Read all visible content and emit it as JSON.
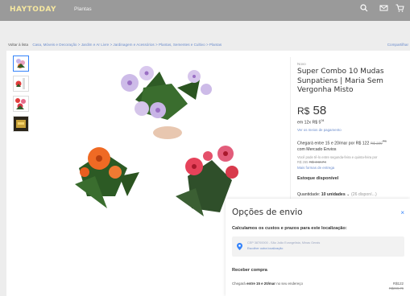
{
  "header": {
    "logo": "HAYTODAY",
    "nav_link": "Plantas",
    "icons": [
      "search-icon",
      "mail-icon",
      "cart-icon"
    ],
    "bg_color": "#9a9a9a"
  },
  "breadcrumb": {
    "back": "Voltar à lista",
    "path": "Casa, Móveis e Decoração > Jardim e Ar Livre > Jardinagem e Acessórios > Plantas, Sementes e Cultivo > Plantas",
    "share": "Compartilhar"
  },
  "product": {
    "condition": "Novo",
    "title": "Super Combo 10 Mudas Sunpatiens | Maria Sem Vergonha Misto",
    "price_currency": "R$",
    "price_value": "58",
    "installments_prefix": "em 12x R$",
    "installments_value": "5",
    "installments_cents": "04",
    "payment_link": "Ver os meios de pagamento",
    "delivery_prefix": "Chegará entre 15 e 20/mar por R$",
    "delivery_price": "122",
    "delivery_old": "R$ 299",
    "delivery_old_cents": "76",
    "delivery_suffix": "com Mercado Envios",
    "alt_delivery": "Você pode tê-lo entre segunda-feira e quinta-feira por",
    "alt_price": "R$ 265",
    "alt_old": "R$ 442,74",
    "more_delivery": "Mais formas de entrega",
    "stock": "Estoque disponível",
    "qty_label": "Quantidade:",
    "qty_value": "10 unidades",
    "qty_avail": "(26 disponí...)"
  },
  "modal": {
    "title": "Opções de envio",
    "close": "×",
    "subtitle": "Calculamos os custos e prazos para este localização:",
    "address": "CEP 38700000 - São João Evangelista, Minas Gerais",
    "change_location": "Escolher outra localização",
    "receive": "Receber compra",
    "line_prefix": "Chegará",
    "line_bold": "entre 15 e 20/mar",
    "line_suffix": "no seu endereço",
    "price": "R$122",
    "price_old": "R$299,76"
  },
  "colors": {
    "accent": "#3483fa",
    "link": "#6b8ccc",
    "green": "#00a650"
  }
}
